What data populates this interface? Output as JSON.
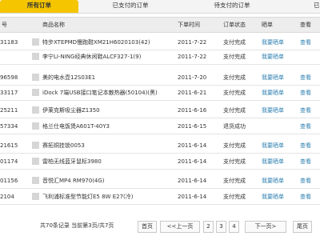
{
  "tabs": [
    {
      "label": "所有订单",
      "active": true
    },
    {
      "label": "已支付的订单",
      "active": false
    },
    {
      "label": "待支付的订单",
      "active": false
    },
    {
      "label": "已",
      "active": false
    }
  ],
  "table": {
    "headers": [
      "号",
      "商品名称",
      "下单时间",
      "订单状态",
      "晒单",
      "查看"
    ],
    "rows": [
      {
        "id": "31183",
        "name": "特步XTEPMD慢跑鞋XM21H6020103(42)",
        "date": "2011-7-22",
        "status": "支付完成",
        "action": "我要晒单",
        "more": "查看"
      },
      {
        "id": "",
        "name": "李宁LI-NING经典休闲鞋ALCF327-1(9)",
        "date": "2011-7-22",
        "status": "支付完成",
        "action": "我要晒单",
        "more": ""
      },
      {
        "id": "96598",
        "name": "美的电水壶12S03E1",
        "date": "2011-7-20",
        "status": "支付完成",
        "action": "我要晒单",
        "more": "查看"
      },
      {
        "id": "33117",
        "name": "iDock 7端USB接口笔记本散热器(50104)(黑)",
        "date": "2011-6-21",
        "status": "支付完成",
        "action": "我要晒单",
        "more": "查看"
      },
      {
        "id": "25211",
        "name": "伊莱克斯吸尘器Z1350",
        "date": "2011-6-16",
        "status": "支付完成",
        "action": "我要晒单",
        "more": "查看"
      },
      {
        "id": "57334",
        "name": "格兰仕电饭煲A601T-40Y3",
        "date": "2011-6-15",
        "status": "退货成功",
        "action": "",
        "more": "查看"
      },
      {
        "id": "21615",
        "name": "赛拓铜挂锁0053",
        "date": "2011-6-14",
        "status": "支付完成",
        "action": "我要晒单",
        "more": "查看"
      },
      {
        "id": "01174",
        "name": "雷柏无线蓝牙鼠标3980",
        "date": "2011-6-14",
        "status": "支付完成",
        "action": "我要晒单",
        "more": "查看"
      },
      {
        "id": "01156",
        "name": "音悦汇MP4 RM970(4G)",
        "date": "2011-6-14",
        "status": "支付完成",
        "action": "我要晒单",
        "more": "查看"
      },
      {
        "id": "2104",
        "name": "飞利浦标准型节能灯E5 8W E27(冷)",
        "date": "2011-6-14",
        "status": "支付完成",
        "action": "我要晒单",
        "more": "查看"
      }
    ]
  },
  "pagination": {
    "summary": "共70条记录 当前第3页/共7页",
    "first": "首页",
    "prev": "<<上一页",
    "pages": [
      "2",
      "3",
      "4"
    ],
    "next": "下一页>",
    "last": "尾页"
  },
  "colors": {
    "tab_active": "#f5c500",
    "link": "#2d7fb0",
    "header_bg": "#ededed"
  }
}
